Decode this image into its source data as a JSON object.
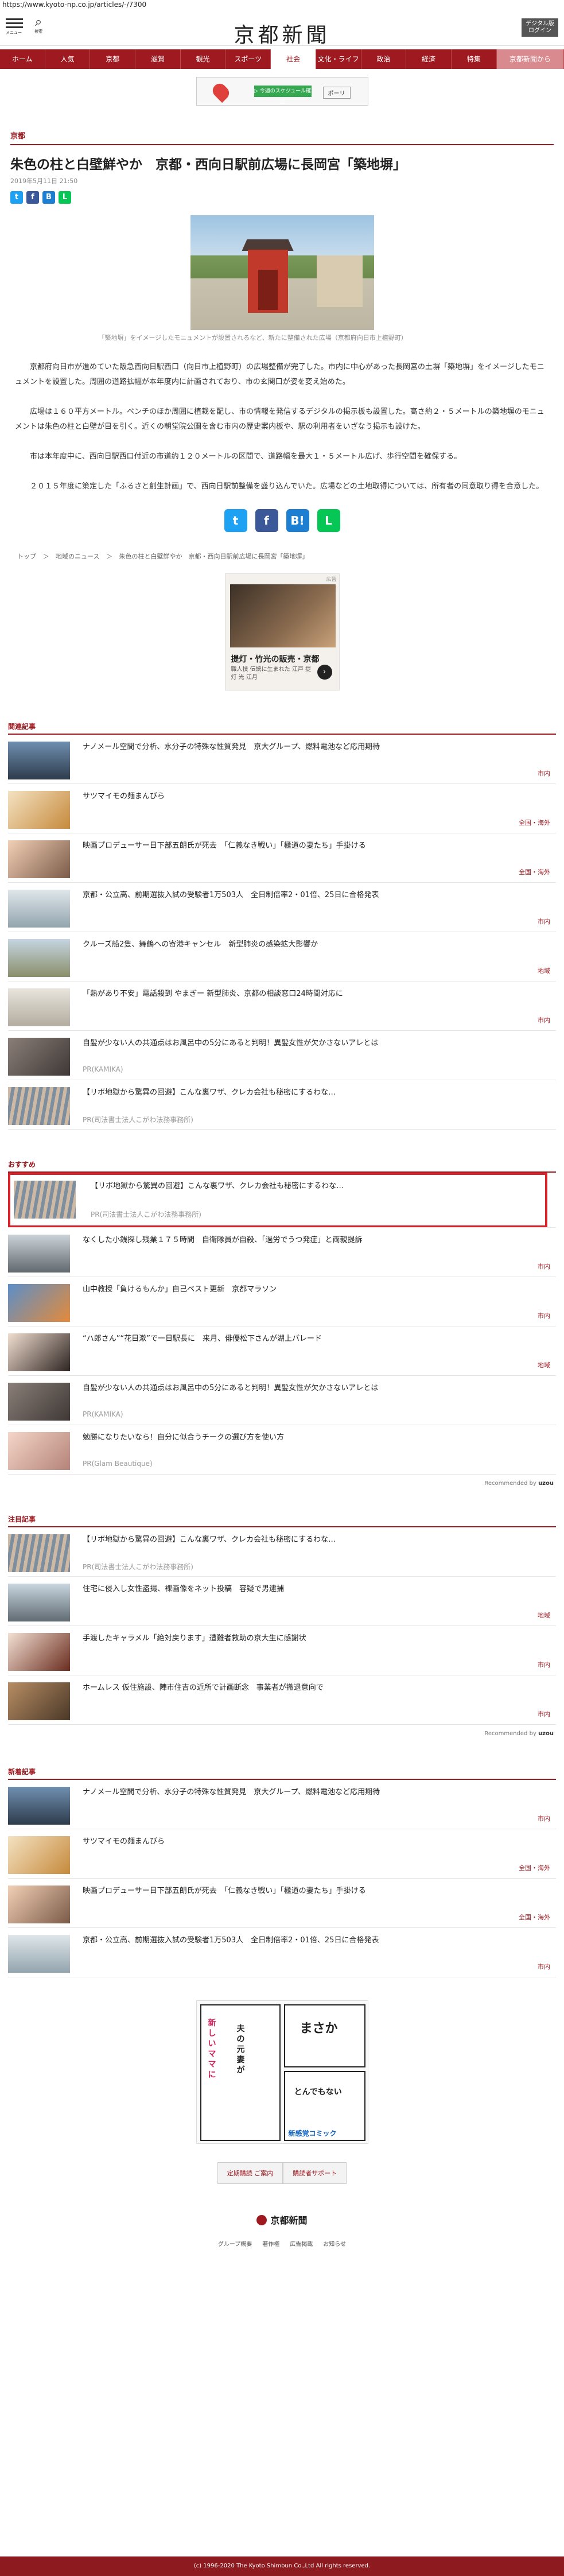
{
  "url": "https://www.kyoto-np.co.jp/articles/-/7300",
  "header": {
    "menu_label": "メニュー",
    "search_label": "検索",
    "logo": "京都新聞",
    "digital_label": "デジタル版\nログイン"
  },
  "nav": [
    "ホーム",
    "人気",
    "京都",
    "滋賀",
    "観光",
    "スポーツ",
    "社会",
    "文化・ライフ",
    "政治",
    "経済",
    "特集",
    "京都新聞から"
  ],
  "nav_active": "社会",
  "top_ad": {
    "green": "▷ 今週のスケジュール確認",
    "pill": "ポーリ"
  },
  "article": {
    "category": "京都",
    "title": "朱色の柱と白壁鮮やか　京都・西向日駅前広場に長岡宮「築地塀」",
    "date": "2019年5月11日 21:50",
    "caption": "「築地塀」をイメージしたモニュメントが設置されるなど、新たに整備された広場（京都府向日市上植野町）",
    "paragraphs": [
      "京都府向日市が進めていた阪急西向日駅西口（向日市上植野町）の広場整備が完了した。市内に中心があった長岡宮の土塀「築地塀」をイメージしたモニュメントを設置した。周囲の道路拡幅が本年度内に計画されており、市の玄関口が姿を変え始めた。",
      "広場は１６０平方メートル。ベンチのほか周囲に植栽を配し、市の情報を発信するデジタルの掲示板も設置した。高さ約２・５メートルの築地塀のモニュメントは朱色の柱と白壁が目を引く。近くの朝堂院公園を含む市内の歴史案内板や、駅の利用者をいざなう掲示も設けた。",
      "市は本年度中に、西向日駅西口付近の市道約１２０メートルの区間で、道路幅を最大１・５メートル広げ、歩行空間を確保する。",
      "２０１５年度に策定した「ふるさと創生計画」で、西向日駅前整備を盛り込んでいた。広場などの土地取得については、所有者の同意取り得を合意した。"
    ]
  },
  "breadcrumb": [
    "トップ",
    "＞",
    "地域のニュース",
    "＞",
    "朱色の柱と白壁鮮やか　京都・西向日駅前広場に長岡宮「築地塀」"
  ],
  "rect_ad": {
    "label": "広告",
    "title": "【京都】",
    "title2": "提灯・竹光の販売・京都",
    "sub": "職人技 伝統に生まれた 江戸 提灯 光 江月",
    "arrow": "›"
  },
  "sections": {
    "related": {
      "label": "関連記事",
      "items": [
        {
          "title": "ナノメール空間で分析、水分子の特殊な性質発見　京大グループ、燃料電池など応用期待",
          "tag": "市内"
        },
        {
          "title": "サツマイモの麺まんびら",
          "tag": "全国・海外"
        },
        {
          "title": "映画プロデューサー日下部五朗氏が死去　「仁義なき戦い」「極道の妻たち」手掛ける",
          "tag": "全国・海外"
        },
        {
          "title": "京都・公立高、前期選抜入試の受験者1万503人　全日制倍率2・01倍、25日に合格発表",
          "tag": "市内"
        },
        {
          "title": "クルーズ船2隻、舞鶴への寄港キャンセル　新型肺炎の感染拡大影響か",
          "tag": "地域"
        },
        {
          "title": "「熱があり不安」電話殺到 やまぎー 新型肺炎、京都の相談窓口24時間対応に",
          "tag": "市内"
        },
        {
          "title": "自髪が少ない人の共通点はお風呂中の5分にあると判明！異髪女性が欠かさないアレとは",
          "pr": "PR(KAMIKA)"
        },
        {
          "title": "【リボ地獄から驚異の回避】こんな裏ワザ、クレカ会社も秘密にするわな…",
          "pr": "PR(司法書士法人こがわ法務事務所)"
        }
      ]
    },
    "recommended": {
      "label": "おすすめ",
      "items": [
        {
          "title": "【リボ地獄から驚異の回避】こんな裏ワザ、クレカ会社も秘密にするわな…",
          "pr": "PR(司法書士法人こがわ法務事務所)"
        },
        {
          "title": "なくした小銭探し残業１７５時間　自衛隊員が自殺、「過労でうつ発症」と両親提訴",
          "tag": "市内"
        },
        {
          "title": "山中教授「負けるもんか」自己ベスト更新　京都マラソン",
          "tag": "市内"
        },
        {
          "title": "“ハ郎さん”“花目漱”で一日駅長に　来月、俳優松下さんが湖上パレード",
          "tag": "地域"
        },
        {
          "title": "自髪が少ない人の共通点はお風呂中の5分にあると判明！異髪女性が欠かさないアレとは",
          "pr": "PR(KAMIKA)"
        },
        {
          "title": "勉勝になりたいなら！自分に似合うチークの選び方を使い方",
          "pr": "PR(Glam Beautique)"
        }
      ],
      "recommended_by": "Recommended by",
      "recommended_brand": "uzou"
    },
    "attention": {
      "label": "注目記事",
      "items": [
        {
          "title": "【リボ地獄から驚異の回避】こんな裏ワザ、クレカ会社も秘密にするわな…",
          "pr": "PR(司法書士法人こがわ法務事務所)"
        },
        {
          "title": "住宅に侵入し女性盗撮、裸画像をネット投稿　容疑で男逮捕",
          "tag": "地域"
        },
        {
          "title": "手渡したキャラメル「絶対戻ります」遭難者救助の京大生に感謝状",
          "tag": "市内"
        },
        {
          "title": "ホームレス 仮住施設、陣市住吉の近所で計画断念　事業者が撤退意向で",
          "tag": "市内"
        }
      ],
      "recommended_by": "Recommended by",
      "recommended_brand": "uzou"
    },
    "latest": {
      "label": "新着記事",
      "items": [
        {
          "title": "ナノメール空間で分析、水分子の特殊な性質発見　京大グループ、燃料電池など応用期待",
          "tag": "市内"
        },
        {
          "title": "サツマイモの麺まんびら",
          "tag": "全国・海外"
        },
        {
          "title": "映画プロデューサー日下部五朗氏が死去　「仁義なき戦い」「極道の妻たち」手掛ける",
          "tag": "全国・海外"
        },
        {
          "title": "京都・公立高、前期選抜入試の受験者1万503人　全日制倍率2・01倍、25日に合格発表",
          "tag": "市内"
        }
      ]
    }
  },
  "manga_ad": {
    "t1": "新しいママに",
    "t2": "夫の元妻が",
    "t3": "まさか",
    "t4": "とんでもない",
    "bottom": "新感覚コミック"
  },
  "footer": {
    "btn1": "定期購読 ご案内",
    "btn2": "購読者サポート",
    "logo": "京都新聞",
    "links": [
      "グループ概要",
      "著作権",
      "広告掲載",
      "お知らせ"
    ],
    "copyright": "(c) 1996-2020 The Kyoto Shimbun Co.,Ltd All rights reserved."
  }
}
